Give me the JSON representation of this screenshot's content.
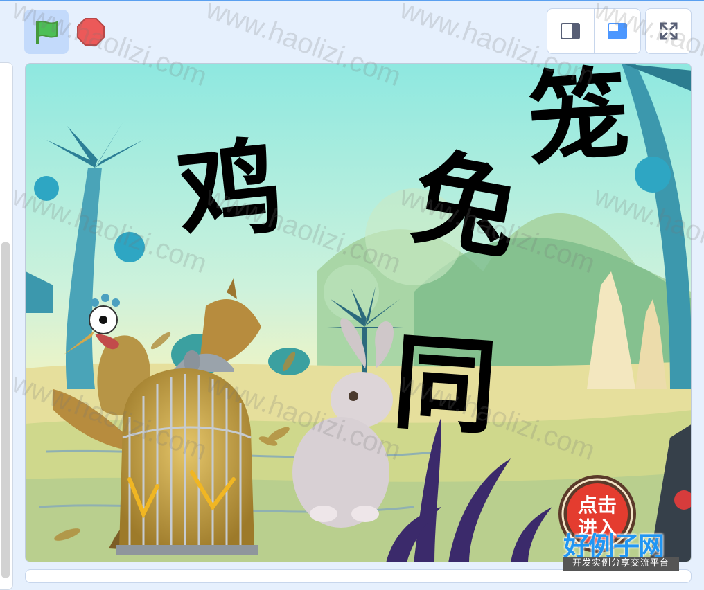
{
  "toolbar": {
    "green_flag_icon": "green-flag-icon",
    "stop_icon": "stop-icon",
    "small_stage_icon": "small-stage-icon",
    "normal_stage_icon": "normal-stage-icon",
    "fullscreen_icon": "fullscreen-icon"
  },
  "stage": {
    "title_chars": [
      "鸡",
      "兔",
      "同",
      "笼"
    ]
  },
  "watermark": {
    "text": "www.haolizi.com"
  },
  "logo": {
    "badge_line1": "点击",
    "badge_line2": "进入",
    "name": "好例子网",
    "tagline": "开发实例分享交流平台"
  },
  "colors": {
    "flag_green": "#4cbf56",
    "stop_red": "#ec5959",
    "accent_blue": "#4c97ff",
    "logo_blue": "#2196f3"
  }
}
